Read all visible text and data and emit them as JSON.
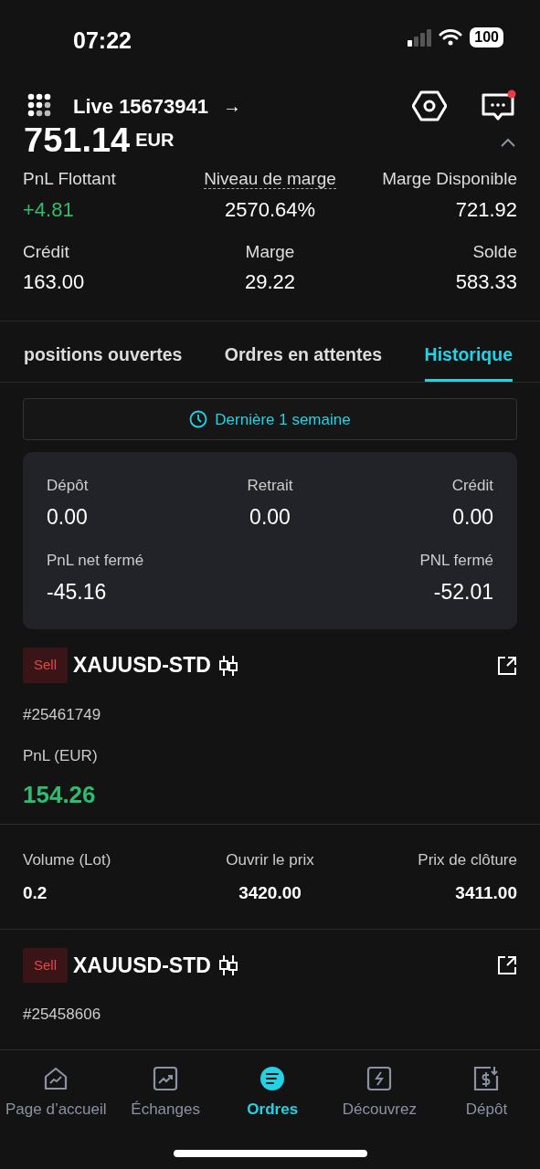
{
  "status_bar": {
    "time": "07:22",
    "battery": "100"
  },
  "header": {
    "account": "Live 15673941",
    "arrow": "→",
    "notification": true
  },
  "balance": {
    "amount": "751.14",
    "currency": "EUR",
    "expanded": true
  },
  "stats": [
    {
      "label": "PnL Flottant",
      "value": "+4.81",
      "positive": true,
      "underlined": false
    },
    {
      "label": "Niveau de marge",
      "value": "2570.64%",
      "positive": false,
      "underlined": true
    },
    {
      "label": "Marge Disponible",
      "value": "721.92",
      "positive": false,
      "underlined": false
    },
    {
      "label": "Crédit",
      "value": "163.00",
      "positive": false,
      "underlined": false
    },
    {
      "label": "Marge",
      "value": "29.22",
      "positive": false,
      "underlined": false
    },
    {
      "label": "Solde",
      "value": "583.33",
      "positive": false,
      "underlined": false
    }
  ],
  "tabs": [
    {
      "label": "positions ouvertes",
      "selected": false
    },
    {
      "label": "Ordres en attentes",
      "selected": false
    },
    {
      "label": "Historique",
      "selected": true
    }
  ],
  "filter": {
    "label": "Dernière 1 semaine"
  },
  "summary": [
    {
      "label": "Dépôt",
      "value": "0.00"
    },
    {
      "label": "Retrait",
      "value": "0.00"
    },
    {
      "label": "Crédit",
      "value": "0.00"
    },
    {
      "label": "PnL net fermé",
      "value": "-45.16"
    },
    {
      "label": "PNL fermé",
      "value": "-52.01"
    }
  ],
  "trades": [
    {
      "side": "Sell",
      "symbol": "XAUUSD-STD",
      "id": "#25461749",
      "pnl_label": "PnL (EUR)",
      "pnl": "154.26",
      "positive": true,
      "details": [
        {
          "label": "Volume (Lot)",
          "value": "0.2"
        },
        {
          "label": "Ouvrir le prix",
          "value": "3420.00"
        },
        {
          "label": "Prix de clôture",
          "value": "3411.00"
        }
      ]
    },
    {
      "side": "Sell",
      "symbol": "XAUUSD-STD",
      "id": "#25458606"
    }
  ],
  "bottom_nav": [
    {
      "label": "Page d’accueil",
      "selected": false,
      "kind": "home"
    },
    {
      "label": "Échanges",
      "selected": false,
      "kind": "trade"
    },
    {
      "label": "Ordres",
      "selected": true,
      "kind": "orders"
    },
    {
      "label": "Découvrez",
      "selected": false,
      "kind": "discover"
    },
    {
      "label": "Dépôt",
      "selected": false,
      "kind": "deposit"
    }
  ]
}
